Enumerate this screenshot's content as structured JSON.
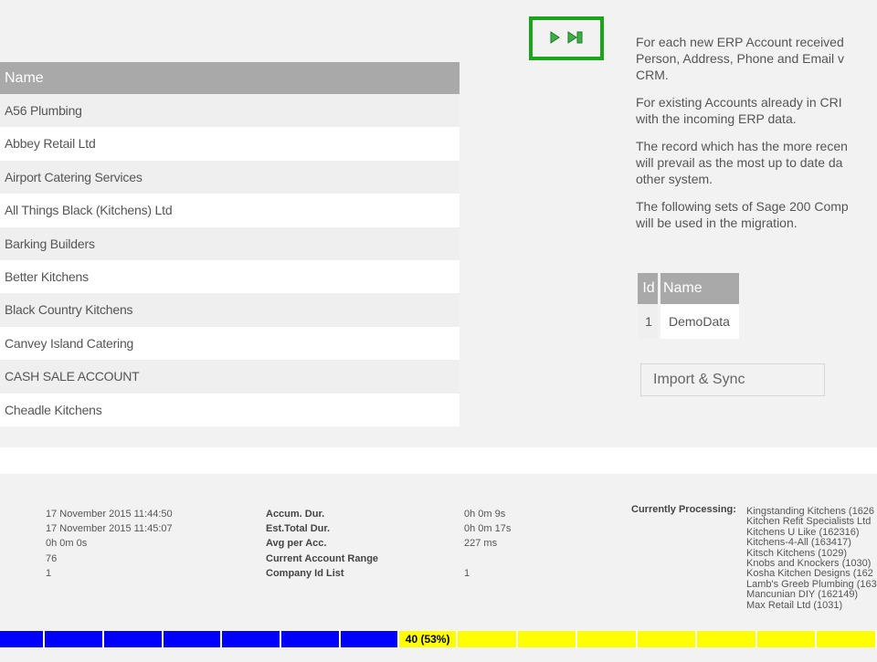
{
  "accounts": {
    "header": "Name",
    "rows": [
      "A56 Plumbing",
      "Abbey Retail Ltd",
      "Airport Catering Services",
      "All Things Black (Kitchens) Ltd",
      "Barking Builders",
      "Better Kitchens",
      "Black Country Kitchens",
      "Canvey Island Catering",
      "CASH SALE ACCOUNT",
      "Cheadle Kitchens"
    ]
  },
  "controls": {
    "play_icon": "play-icon",
    "skip_icon": "skip-to-end-icon",
    "highlight_color": "#1ba51b"
  },
  "description": {
    "p1": [
      "For each new ERP Account received",
      "Person, Address, Phone and Email v",
      "CRM."
    ],
    "p2": [
      "For existing Accounts already in CRI",
      "with the incoming ERP data."
    ],
    "p3": [
      "The record which has the more recen",
      "will prevail as the most up to date da",
      "other system."
    ],
    "p4": [
      "The following sets of Sage 200 Comp",
      "will be used in the migration."
    ]
  },
  "company": {
    "headers": {
      "id": "Id",
      "name": "Name"
    },
    "rows": [
      {
        "id": "1",
        "name": "DemoData"
      }
    ]
  },
  "sync_button": "Import & Sync",
  "stats": {
    "col1": [
      "17 November 2015 11:44:50",
      "17 November 2015 11:45:07",
      "0h 0m 0s",
      "76",
      "1"
    ],
    "col2_labels": [
      "Accum. Dur.",
      "Est.Total Dur.",
      "Avg per Acc.",
      "Current Account Range",
      "Company Id List"
    ],
    "col3": [
      "0h 0m 9s",
      "0h 0m 17s",
      "227 ms",
      "",
      "1"
    ],
    "currently_processing_label": "Currently Processing:",
    "currently_processing": [
      "Kingstanding Kitchens (1626",
      "Kitchen Refit Specialists Ltd",
      "Kitchens U Like (162316)",
      "Kitchens-4-All (163417)",
      "Kitsch Kitchens (1029)",
      "Knobs and Knockers (1030)",
      "Kosha Kitchen Designs (162",
      "Lamb's Greeb Plumbing (163",
      "Mancunian DIY (162149)",
      "Max Retail Ltd (1031)"
    ]
  },
  "progress": {
    "label": "40 (53%)",
    "fraction": 0.53,
    "done_color": "#0000ff",
    "todo_color": "#ffff00"
  }
}
